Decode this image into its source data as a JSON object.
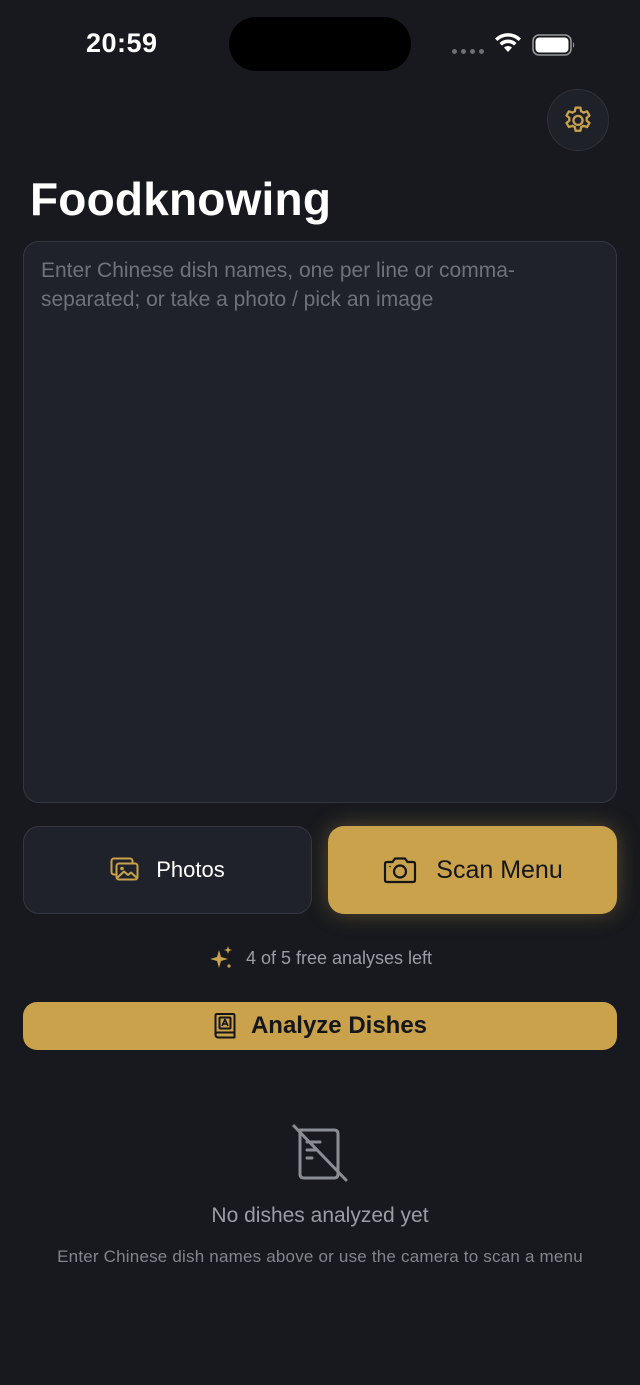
{
  "status_bar": {
    "time": "20:59"
  },
  "header": {
    "title": "Foodknowing",
    "settings_icon": "gear-icon"
  },
  "input": {
    "placeholder": "Enter Chinese dish names, one per line or comma-separated; or take a photo / pick an image",
    "value": ""
  },
  "actions": {
    "photos_label": "Photos",
    "photos_icon": "photos-icon",
    "scan_label": "Scan Menu",
    "scan_icon": "camera-icon"
  },
  "quota": {
    "text": "4 of 5 free analyses left",
    "icon": "sparkles-icon"
  },
  "analyze": {
    "label": "Analyze Dishes",
    "icon": "menu-book-icon"
  },
  "empty_state": {
    "icon": "no-menu-icon",
    "title": "No dishes analyzed yet",
    "subtitle": "Enter Chinese dish names above or use the camera to scan a menu"
  },
  "colors": {
    "background": "#17191e",
    "card": "#1f222a",
    "accent": "#c9a24b",
    "muted_text": "#9a9da4"
  }
}
